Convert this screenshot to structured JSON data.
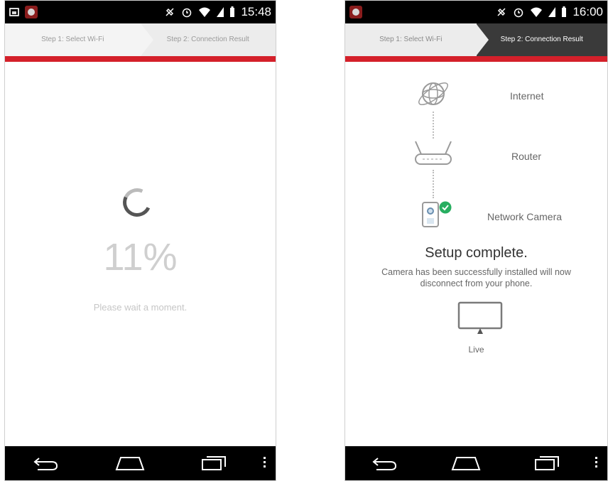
{
  "left": {
    "status_time": "15:48",
    "steps": [
      "Step 1: Select Wi-Fi",
      "Step 2: Connection Result"
    ],
    "progress_percent": "11%",
    "wait_message": "Please wait a moment."
  },
  "right": {
    "status_time": "16:00",
    "steps": [
      "Step 1: Select Wi-Fi",
      "Step 2: Connection Result"
    ],
    "nodes": [
      "Internet",
      "Router",
      "Network Camera"
    ],
    "setup_title": "Setup complete.",
    "setup_message": "Camera has been successfully installed will now disconnect from your phone.",
    "live_label": "Live"
  },
  "colors": {
    "accent_red": "#d4202a",
    "status_bar": "#000000",
    "active_step": "#3a3a3a",
    "check_green": "#27ae60"
  }
}
